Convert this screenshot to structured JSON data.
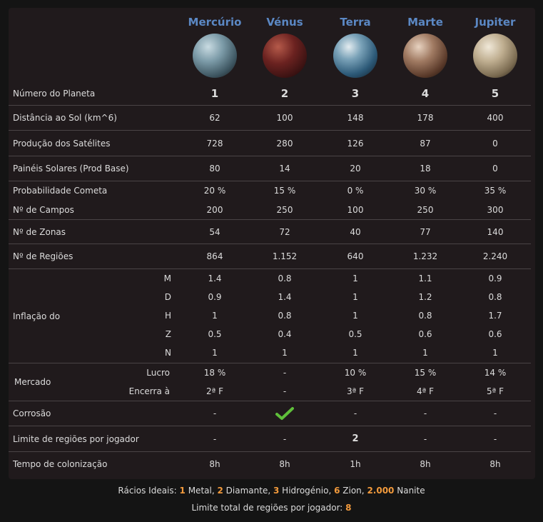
{
  "planets": [
    {
      "name": "Mercúrio",
      "number": "1",
      "distance": "62",
      "satellite_production": "728",
      "solar_panels": "80",
      "comet_probability": "20 %",
      "fields": "200",
      "zones": "54",
      "regions": "864",
      "inflation": {
        "M": "1.4",
        "D": "0.9",
        "H": "1",
        "Z": "0.5",
        "N": "1"
      },
      "market_profit": "18 %",
      "market_closes": "2ª F",
      "corrosion": "-",
      "region_limit": "-",
      "colonization_time": "8h"
    },
    {
      "name": "Vénus",
      "number": "2",
      "distance": "100",
      "satellite_production": "280",
      "solar_panels": "14",
      "comet_probability": "15 %",
      "fields": "250",
      "zones": "72",
      "regions": "1.152",
      "inflation": {
        "M": "0.8",
        "D": "1.4",
        "H": "0.8",
        "Z": "0.4",
        "N": "1"
      },
      "market_profit": "-",
      "market_closes": "-",
      "corrosion": "check",
      "region_limit": "-",
      "colonization_time": "8h"
    },
    {
      "name": "Terra",
      "number": "3",
      "distance": "148",
      "satellite_production": "126",
      "solar_panels": "20",
      "comet_probability": "0 %",
      "fields": "100",
      "zones": "40",
      "regions": "640",
      "inflation": {
        "M": "1",
        "D": "1",
        "H": "1",
        "Z": "0.5",
        "N": "1"
      },
      "market_profit": "10 %",
      "market_closes": "3ª F",
      "corrosion": "-",
      "region_limit": "2",
      "colonization_time": "1h"
    },
    {
      "name": "Marte",
      "number": "4",
      "distance": "178",
      "satellite_production": "87",
      "solar_panels": "18",
      "comet_probability": "30 %",
      "fields": "250",
      "zones": "77",
      "regions": "1.232",
      "inflation": {
        "M": "1.1",
        "D": "1.2",
        "H": "0.8",
        "Z": "0.6",
        "N": "1"
      },
      "market_profit": "15 %",
      "market_closes": "4ª F",
      "corrosion": "-",
      "region_limit": "-",
      "colonization_time": "8h"
    },
    {
      "name": "Jupiter",
      "number": "5",
      "distance": "400",
      "satellite_production": "0",
      "solar_panels": "0",
      "comet_probability": "35 %",
      "fields": "300",
      "zones": "140",
      "regions": "2.240",
      "inflation": {
        "M": "0.9",
        "D": "0.8",
        "H": "1.7",
        "Z": "0.6",
        "N": "1"
      },
      "market_profit": "14 %",
      "market_closes": "5ª F",
      "corrosion": "-",
      "region_limit": "-",
      "colonization_time": "8h"
    }
  ],
  "labels": {
    "number": "Número do Planeta",
    "distance": "Distância ao Sol (km^6)",
    "satellite_production": "Produção dos Satélites",
    "solar_panels": "Painéis Solares (Prod Base)",
    "comet_probability": "Probabilidade Cometa",
    "fields": "Nº de Campos",
    "zones": "Nº de Zonas",
    "regions": "Nº de Regiões",
    "inflation": "Inflação do",
    "inflation_keys": [
      "M",
      "D",
      "H",
      "Z",
      "N"
    ],
    "market": "Mercado",
    "market_profit": "Lucro",
    "market_closes": "Encerra à",
    "corrosion": "Corrosão",
    "region_limit": "Limite de regiões por jogador",
    "colonization_time": "Tempo de colonização"
  },
  "footer": {
    "ratios_label": "Rácios Ideais:",
    "ratios": [
      {
        "value": "1",
        "name": "Metal"
      },
      {
        "value": "2",
        "name": "Diamante"
      },
      {
        "value": "3",
        "name": "Hidrogénio"
      },
      {
        "value": "6",
        "name": "Zion"
      },
      {
        "value": "2.000",
        "name": "Nanite"
      }
    ],
    "total_limit_label": "Limite total de regiões por jogador:",
    "total_limit_value": "8"
  },
  "colors": {
    "planet_name": "#5b88c4",
    "highlight": "#f29a3c",
    "check": "#5fbf3a"
  }
}
